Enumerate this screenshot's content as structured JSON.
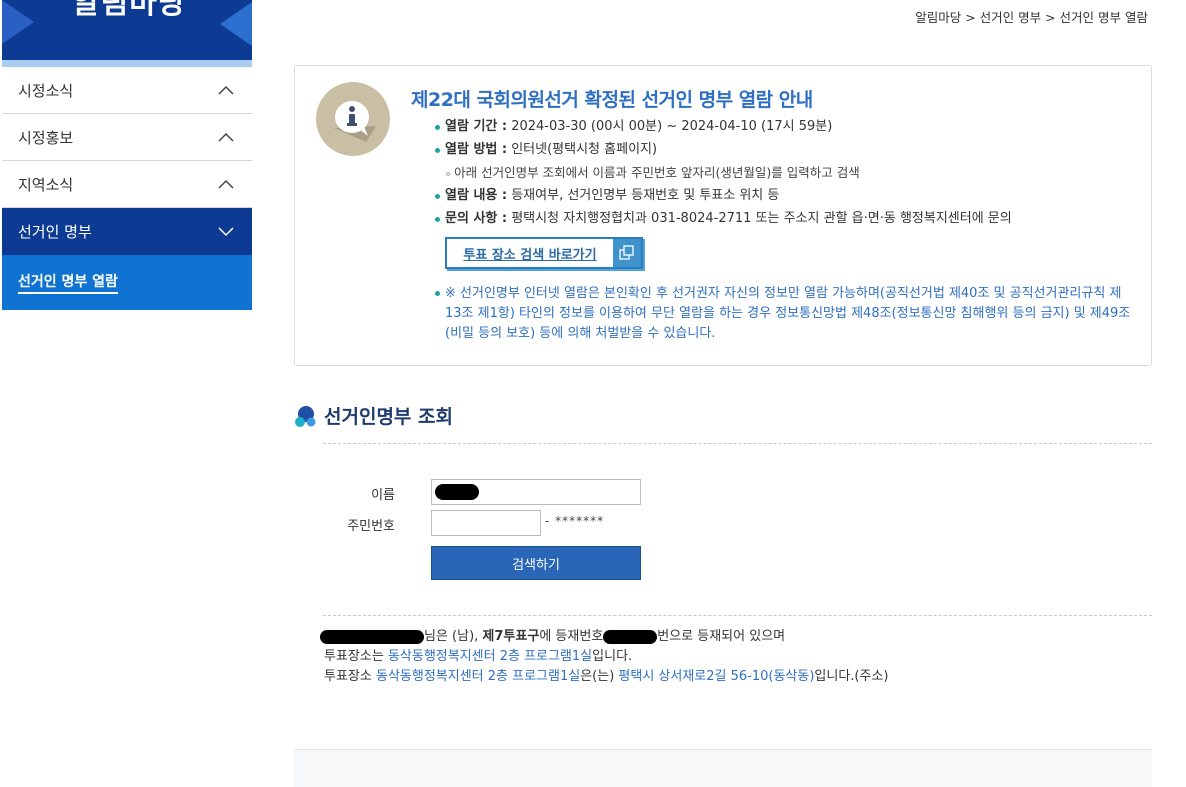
{
  "sidebar": {
    "banner_title": "알림마당",
    "menu": [
      {
        "label": "시정소식"
      },
      {
        "label": "시정홍보"
      },
      {
        "label": "지역소식"
      },
      {
        "label": "선거인 명부"
      }
    ],
    "submenu": [
      {
        "label": "선거인 명부 열람"
      }
    ]
  },
  "breadcrumb": {
    "text": "알림마당 > 선거인 명부 > 선거인 명부 열람"
  },
  "notice": {
    "title": "제22대 국회의원선거 확정된 선거인 명부 열람 안내",
    "rows": [
      {
        "key": "열람 기간 :",
        "value": " 2024-03-30 (00시 00분) ~ 2024-04-10 (17시 59분)"
      },
      {
        "key": "열람 방법 :",
        "value": " 인터넷(평택시청 홈페이지)"
      },
      {
        "sub": "아래 선거인명부 조회에서 이름과 주민번호 앞자리(생년월일)를 입력하고 검색"
      },
      {
        "key": "열람 내용 :",
        "value": " 등재여부, 선거인명부 등재번호 및 투표소 위치 등"
      },
      {
        "key": "문의 사항 :",
        "value": " 평택시청 자치행정협치과 031-8024-2711 또는 주소지 관할 읍·면·동 행정복지센터에 문의"
      }
    ],
    "link_button": "투표 장소 검색 바로가기",
    "warning": "※ 선거인명부 인터넷 열람은 본인확인 후 선거권자 자신의 정보만 열람 가능하며(공직선거법 제40조 및 공직선거관리규칙 제13조 제1항) 타인의 정보를 이용하여 무단 열람을 하는 경우 정보통신망법 제48조(정보통신망 침해행위 등의 금지) 및 제49조(비밀 등의 보호) 등에 의해 처벌받을 수 있습니다."
  },
  "search": {
    "section_title": "선거인명부 조회",
    "name_label": "이름",
    "rrn_label": "주민번호",
    "rrn_mask": "- *******",
    "button": "검색하기"
  },
  "result": {
    "line1_a": "님은 (남), ",
    "line1_b": "제7투표구",
    "line1_c": "에 등재번호",
    "line1_d": "번으로 등재되어 있으며",
    "line2_a": "투표장소는 ",
    "line2_b": "동삭동행정복지센터 2층 프로그램1실",
    "line2_c": "입니다.",
    "line3_a": "투표장소 ",
    "line3_b": "동삭동행정복지센터 2층 프로그램1실",
    "line3_c": "은(는) ",
    "line3_d": "평택시 상서재로2길 56-10(동삭동)",
    "line3_e": "입니다.(주소)"
  }
}
